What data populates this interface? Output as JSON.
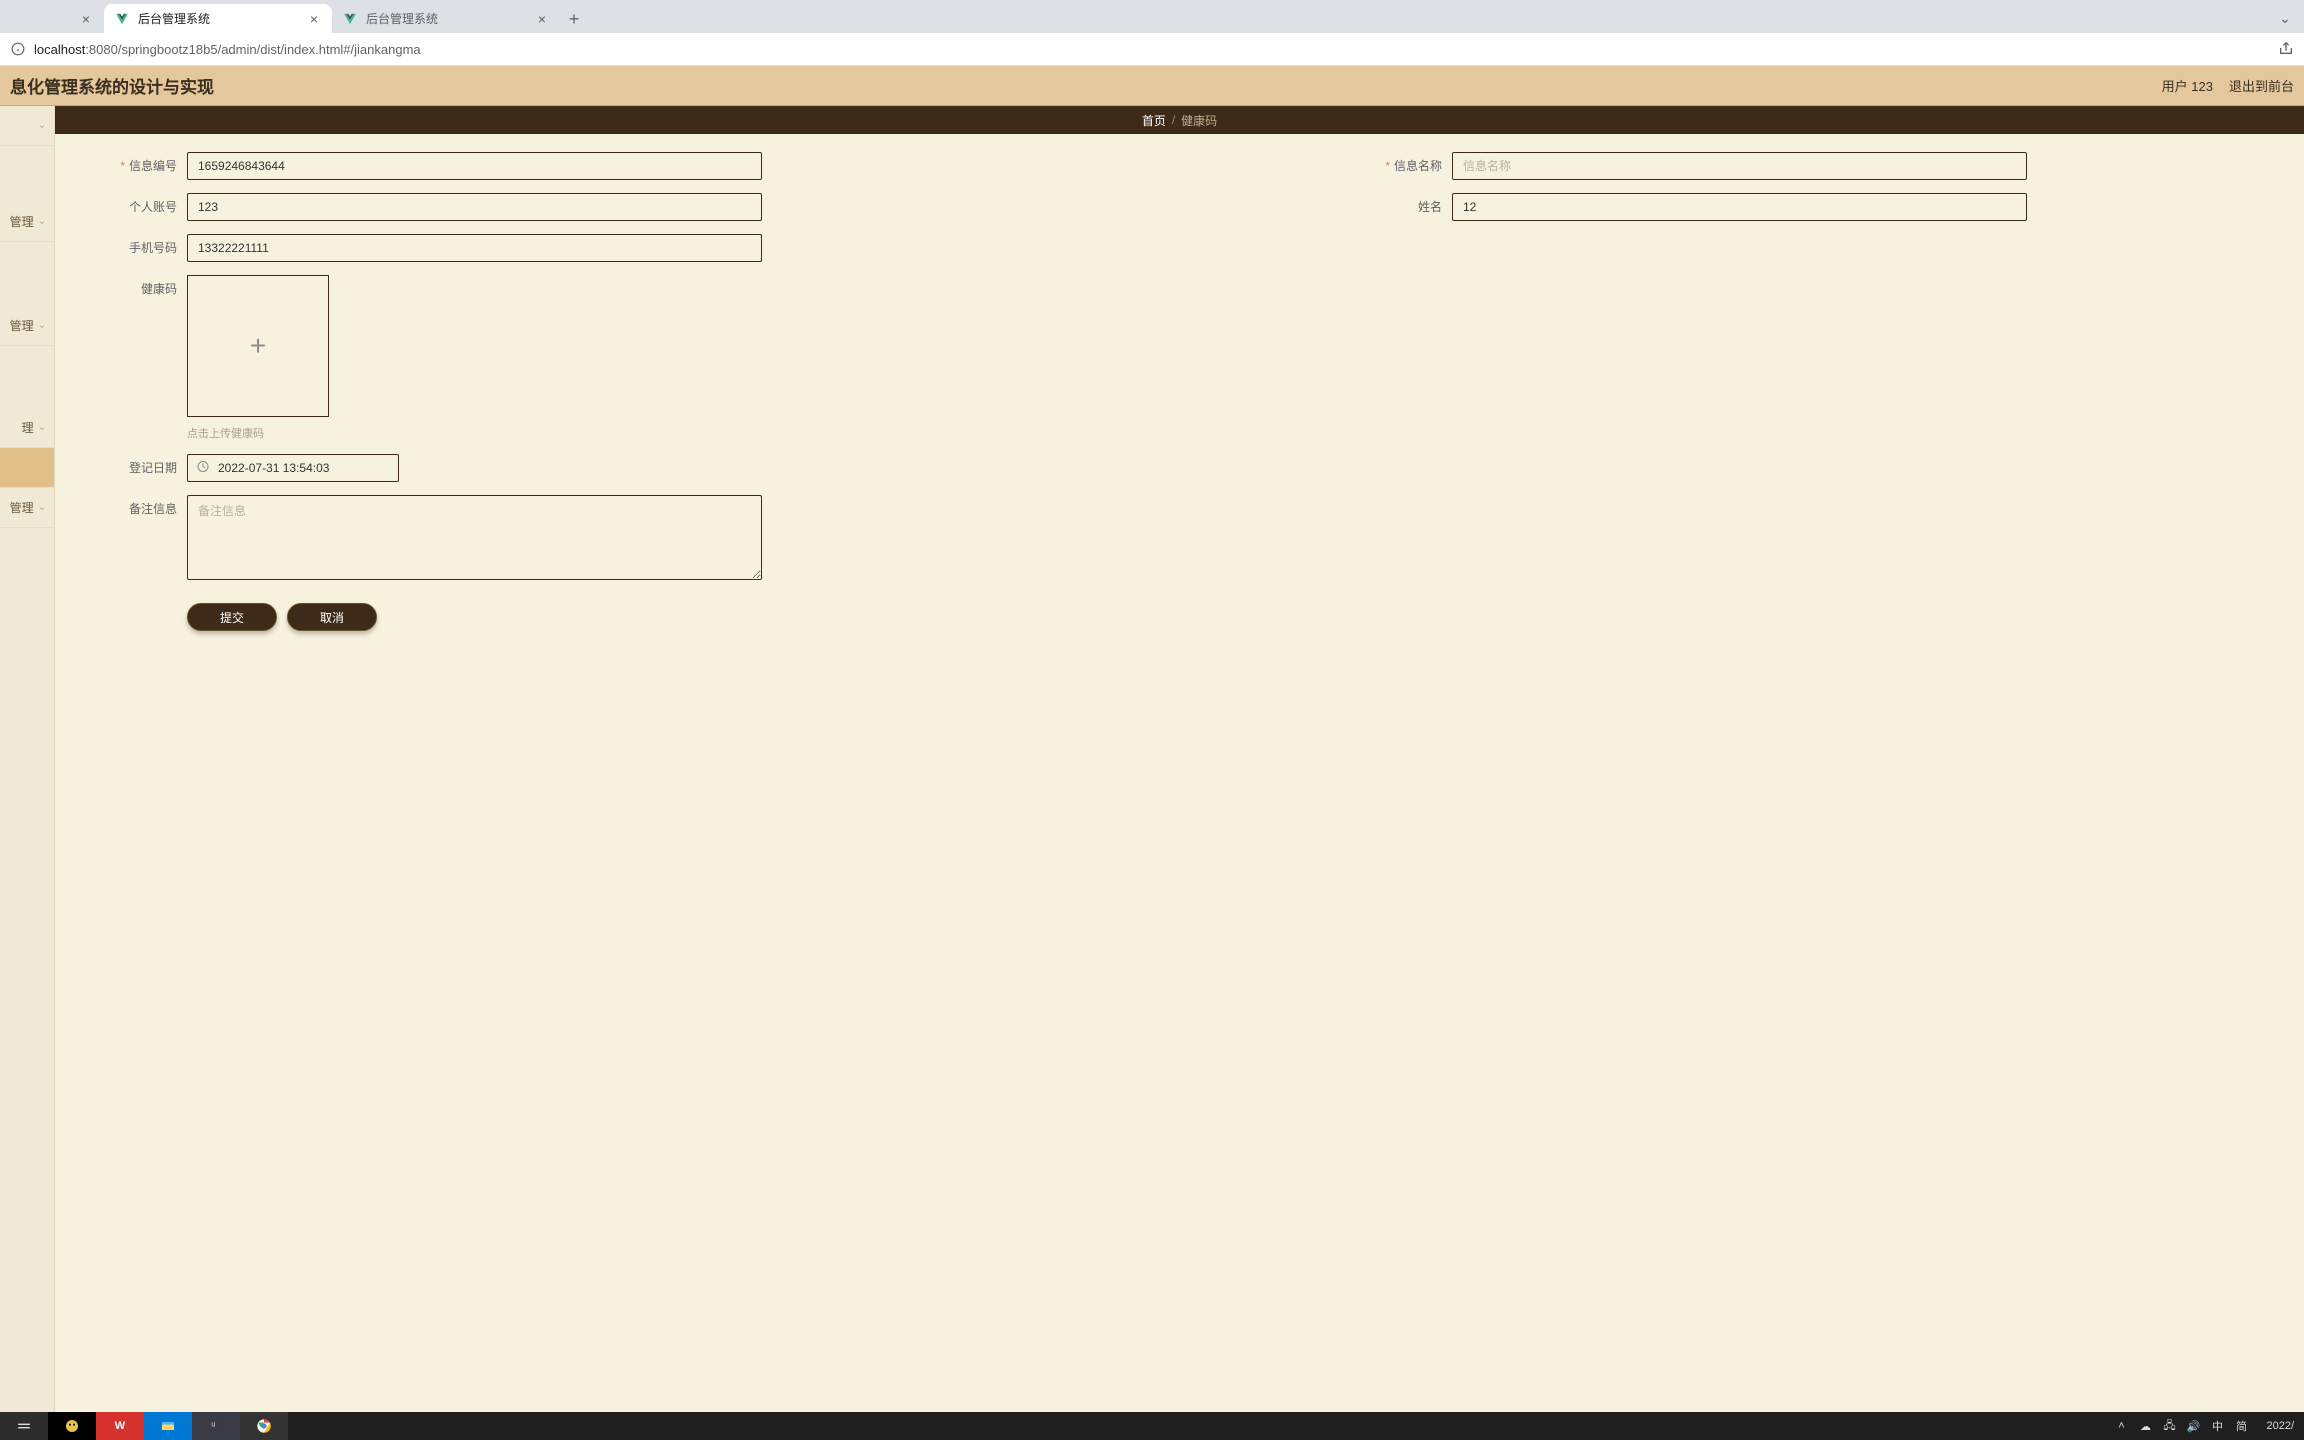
{
  "browser": {
    "tabs": [
      {
        "title": "",
        "active": false,
        "blank": true
      },
      {
        "title": "后台管理系统",
        "active": true
      },
      {
        "title": "后台管理系统",
        "active": false
      }
    ],
    "url_host": "localhost",
    "url_path": ":8080/springbootz18b5/admin/dist/index.html#/jiankangma"
  },
  "header": {
    "title": "息化管理系统的设计与实现",
    "user_label": "用户 123",
    "logout_label": "退出到前台"
  },
  "sidebar": {
    "items": [
      {
        "label": ""
      },
      {
        "label": "管理"
      },
      {
        "label": "管理"
      },
      {
        "label": "理"
      },
      {
        "label": "",
        "active": true
      },
      {
        "label": "管理"
      }
    ]
  },
  "breadcrumb": {
    "home": "首页",
    "sep": "/",
    "current": "健康码"
  },
  "form": {
    "info_number_label": "信息编号",
    "info_number_value": "1659246843644",
    "info_name_label": "信息名称",
    "info_name_placeholder": "信息名称",
    "info_name_value": "",
    "personal_account_label": "个人账号",
    "personal_account_value": "123",
    "name_label": "姓名",
    "name_value": "12",
    "phone_label": "手机号码",
    "phone_value": "13322221111",
    "healthcode_label": "健康码",
    "healthcode_tip": "点击上传健康码",
    "register_date_label": "登记日期",
    "register_date_value": "2022-07-31 13:54:03",
    "remark_label": "备注信息",
    "remark_placeholder": "备注信息",
    "remark_value": "",
    "submit_label": "提交",
    "cancel_label": "取消"
  },
  "taskbar": {
    "ime": "中",
    "ime2": "简",
    "clock": "2022/"
  }
}
